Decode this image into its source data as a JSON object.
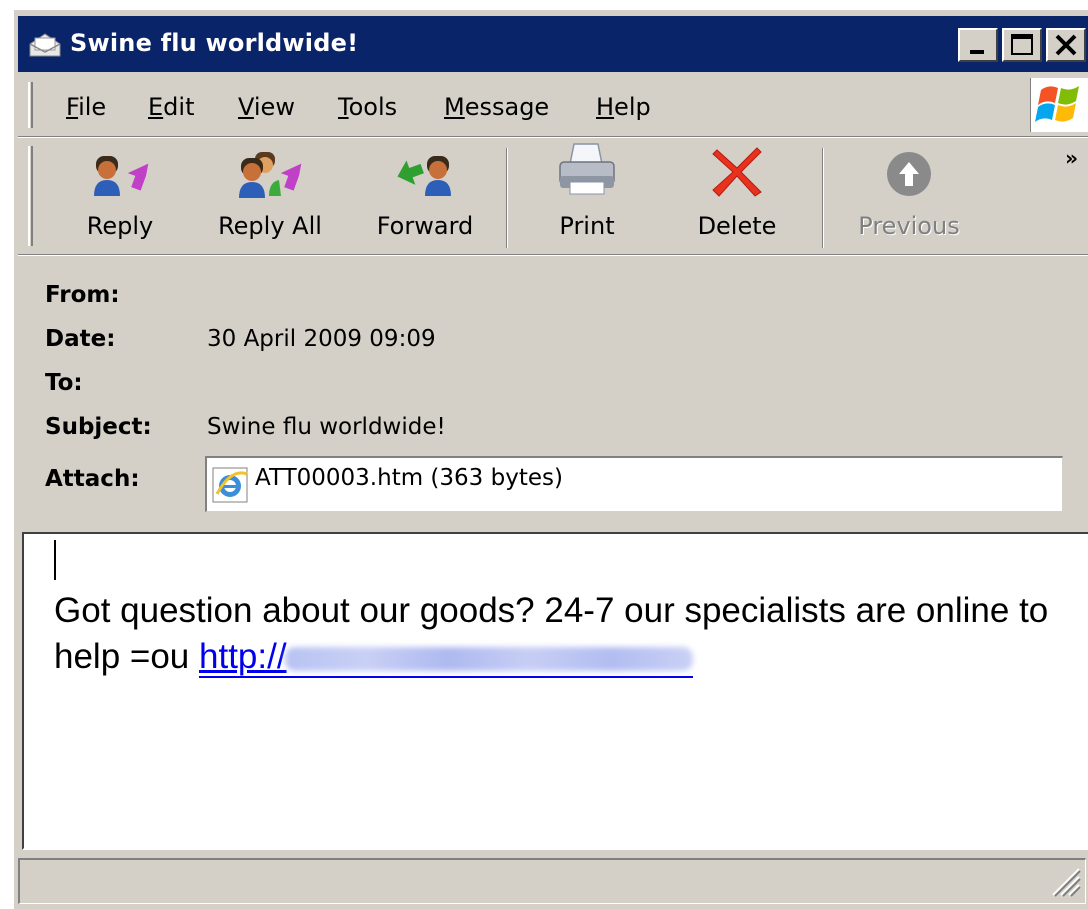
{
  "window": {
    "title": "Swine flu worldwide!"
  },
  "menu": {
    "items": [
      {
        "label": "File",
        "underline": "F",
        "rest": "ile"
      },
      {
        "label": "Edit",
        "underline": "E",
        "rest": "dit"
      },
      {
        "label": "View",
        "underline": "V",
        "rest": "iew"
      },
      {
        "label": "Tools",
        "underline": "T",
        "rest": "ools"
      },
      {
        "label": "Message",
        "underline": "M",
        "rest": "essage"
      },
      {
        "label": "Help",
        "underline": "H",
        "rest": "elp"
      }
    ]
  },
  "toolbar": {
    "reply": "Reply",
    "reply_all": "Reply All",
    "forward": "Forward",
    "print": "Print",
    "delete": "Delete",
    "previous": "Previous",
    "more": "»"
  },
  "headers": {
    "from_label": "From:",
    "from_value": "",
    "date_label": "Date:",
    "date_value": "30 April 2009 09:09",
    "to_label": "To:",
    "to_value": "",
    "subject_label": "Subject:",
    "subject_value": "Swine flu worldwide!",
    "attach_label": "Attach:",
    "attachment": "ATT00003.htm (363 bytes)"
  },
  "message": {
    "text": "Got question about our goods? 24-7 our specialists are online to help =ou ",
    "link_visible": "http://",
    "link_blurred": true
  },
  "colors": {
    "titlebar": "#0a246a",
    "chrome": "#d4d0c8",
    "link": "#0000ee",
    "delete_icon": "#e8321e"
  },
  "icons": {
    "app": "open-envelope-icon",
    "reply": "reply-icon",
    "reply_all": "reply-all-icon",
    "forward": "forward-icon",
    "print": "printer-icon",
    "delete": "red-x-icon",
    "previous": "up-arrow-circle-icon",
    "attachment": "internet-explorer-icon"
  }
}
